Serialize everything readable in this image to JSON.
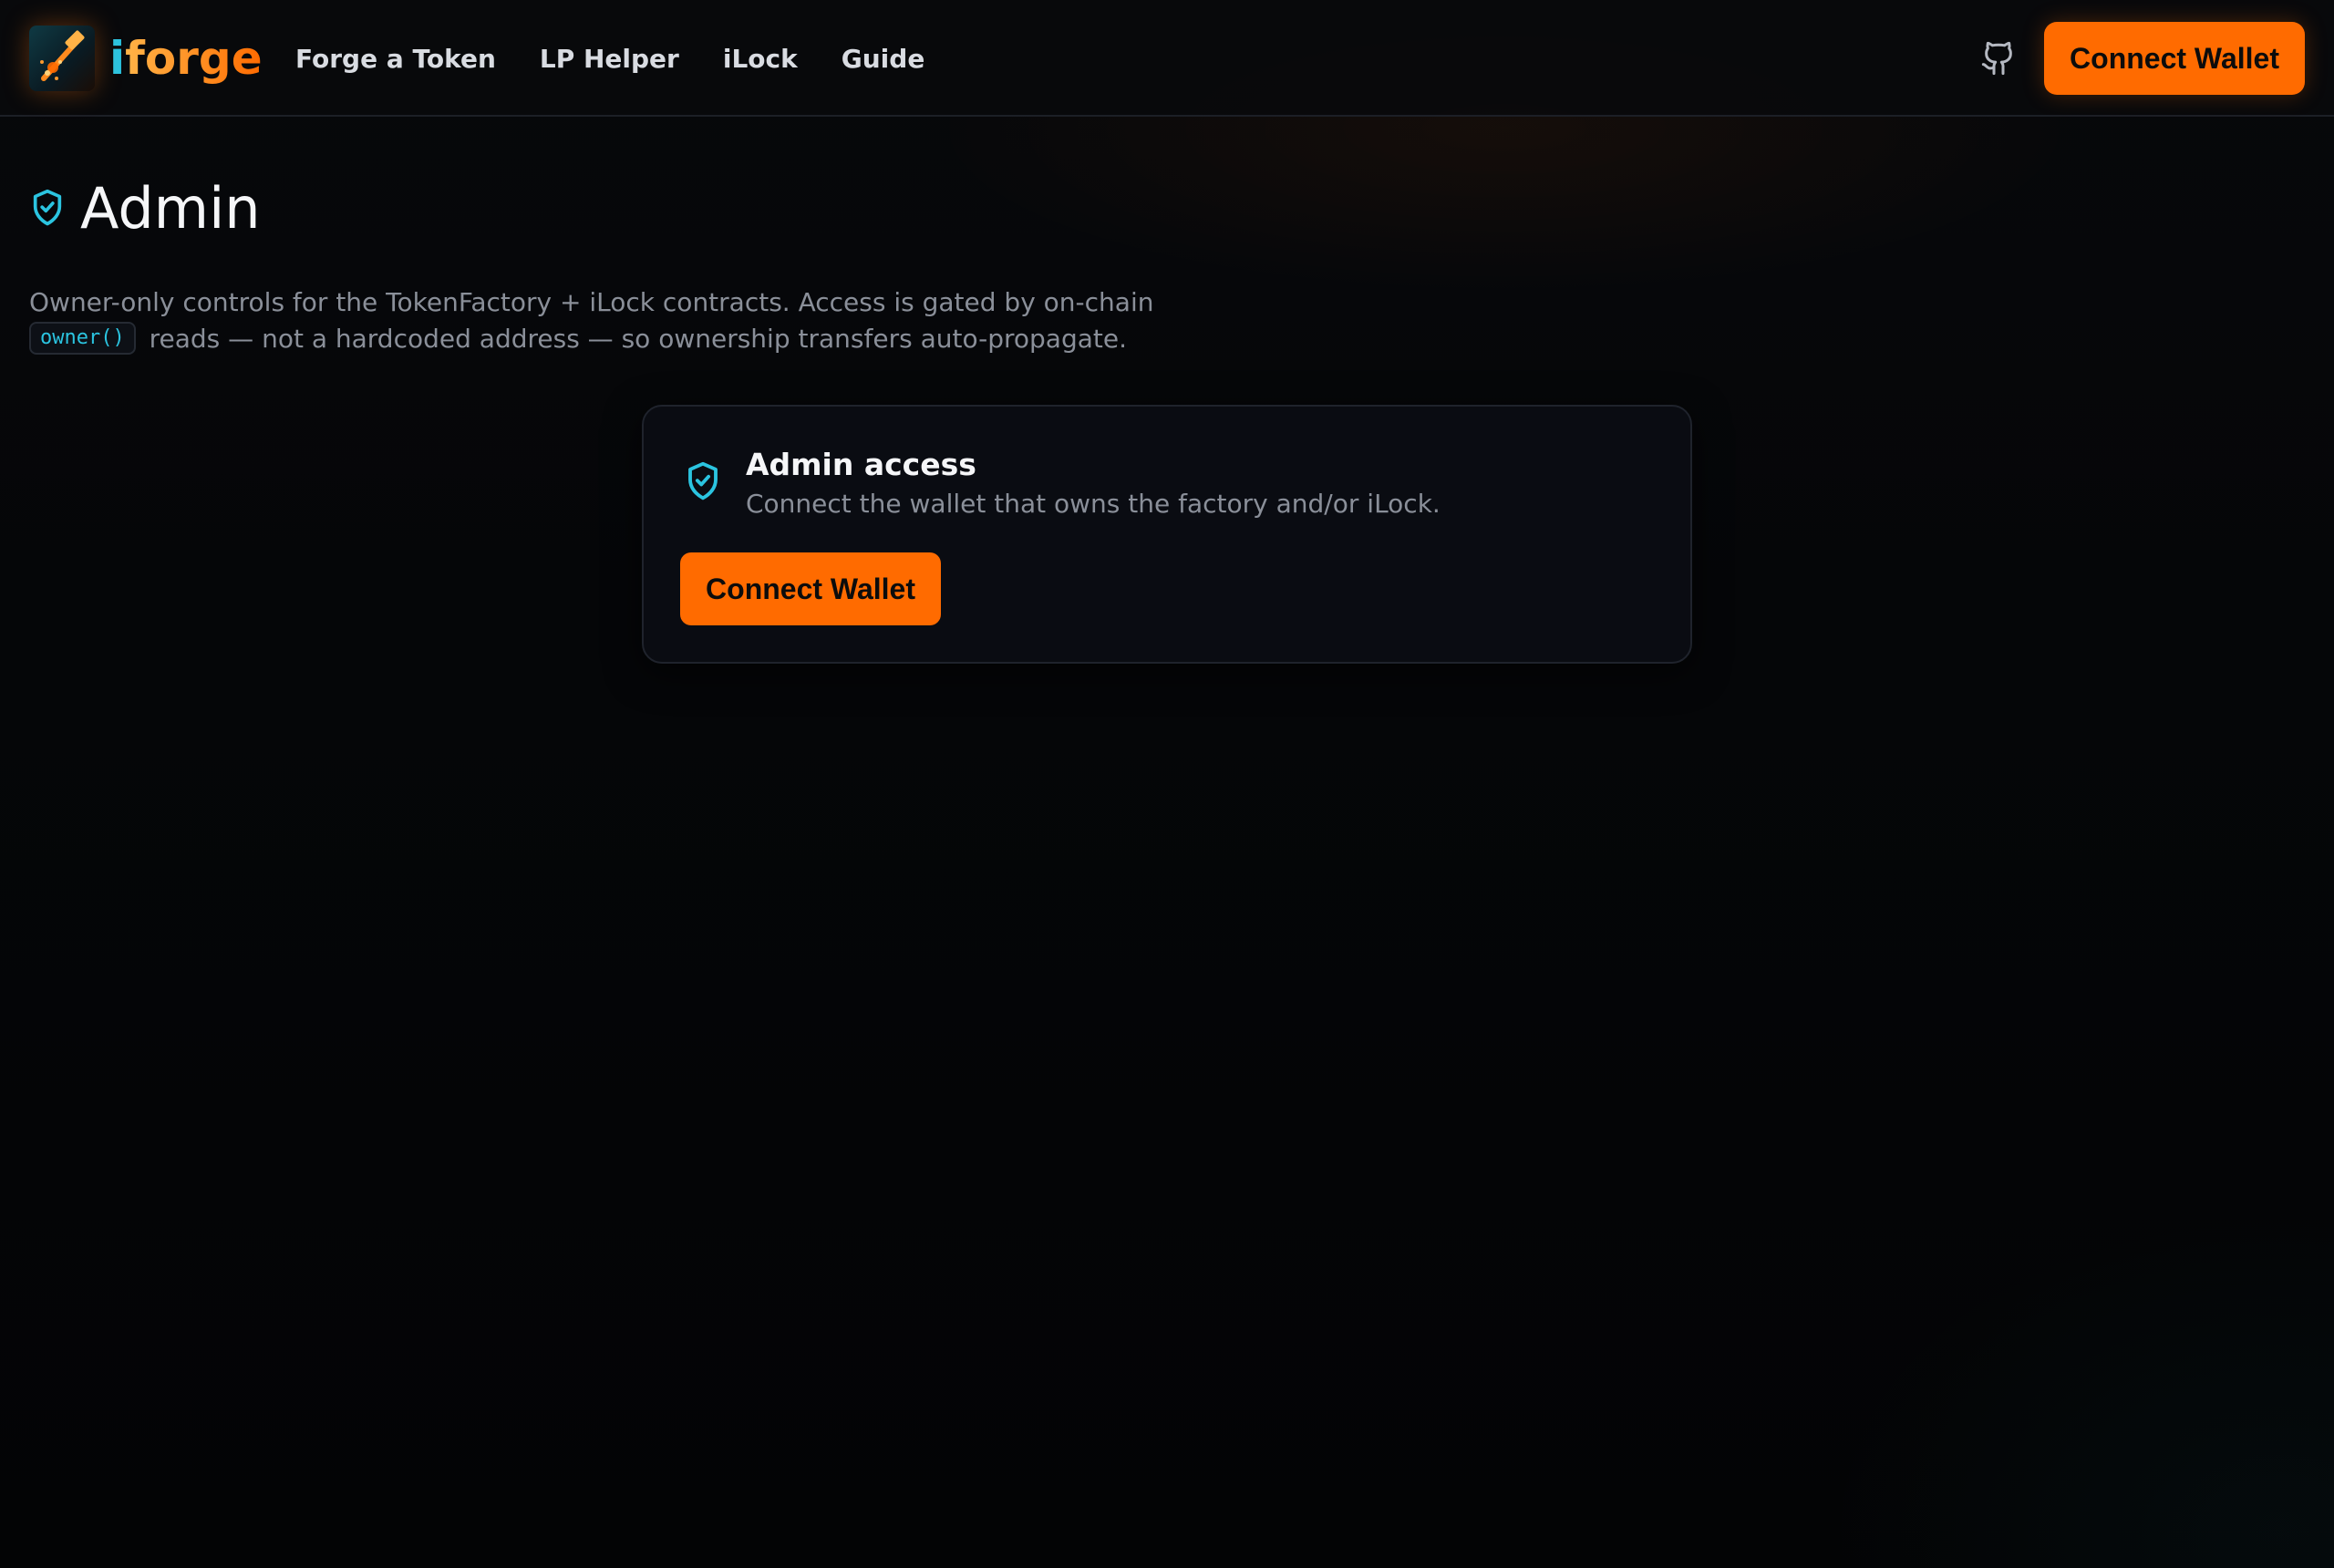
{
  "brand": {
    "name_prefix": "i",
    "name_rest": "forge",
    "logo_icon": "forge-hammer-icon"
  },
  "nav": {
    "items": [
      {
        "label": "Forge a Token"
      },
      {
        "label": "LP Helper"
      },
      {
        "label": "iLock"
      },
      {
        "label": "Guide"
      }
    ]
  },
  "header": {
    "github_icon": "github-icon",
    "connect_label": "Connect Wallet"
  },
  "page": {
    "title": "Admin",
    "title_icon": "shield-check-icon",
    "description_before": "Owner-only controls for the TokenFactory + iLock contracts. Access is gated by on-chain",
    "code": "owner()",
    "description_after": "reads — not a hardcoded address — so ownership transfers auto-propagate."
  },
  "card": {
    "icon": "shield-check-icon",
    "title": "Admin access",
    "subtitle": "Connect the wallet that owns the factory and/or iLock.",
    "connect_label": "Connect Wallet"
  },
  "colors": {
    "accent": "#ff6b00",
    "cyan": "#2bc4e0",
    "background": "#040507",
    "muted_text": "#8a8f99"
  }
}
